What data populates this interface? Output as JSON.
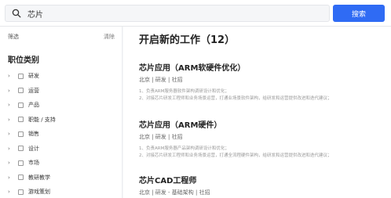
{
  "search": {
    "value": "芯片",
    "button_label": "搜索"
  },
  "sidebar": {
    "filter_label": "筛选",
    "clear_label": "清除",
    "category_title": "职位类别",
    "categories": [
      {
        "label": "研发"
      },
      {
        "label": "运营"
      },
      {
        "label": "产品"
      },
      {
        "label": "职能 / 支持"
      },
      {
        "label": "销售"
      },
      {
        "label": "设计"
      },
      {
        "label": "市场"
      },
      {
        "label": "教研教学"
      },
      {
        "label": "游戏策划"
      }
    ]
  },
  "main": {
    "title": "开启新的工作（12）",
    "jobs": [
      {
        "title": "芯片应用（ARM软硬件优化）",
        "meta": "北京 | 研发 | 社招",
        "desc": [
          "1、负责ARM服务器软件架构调研设计和优化；",
          "2、对接芯片研发工程师和业务场景运营，打通业场景软件架构，给研发和运营提供改进和迭代建议；"
        ]
      },
      {
        "title": "芯片应用（ARM硬件）",
        "meta": "北京 | 研发 | 社招",
        "desc": [
          "1、负责ARM服务器产品架构调研设计和优化；",
          "2、对接芯片研发工程师和业务场景运营，打通全流程硬件架构，给研发和运营提供改进和迭代建议；"
        ]
      },
      {
        "title": "芯片CAD工程师",
        "meta": "北京 | 研发 - 基础架构 | 社招",
        "desc": []
      }
    ]
  },
  "colors": {
    "accent": "#2f6bf4",
    "background": "#f4f5f7"
  }
}
